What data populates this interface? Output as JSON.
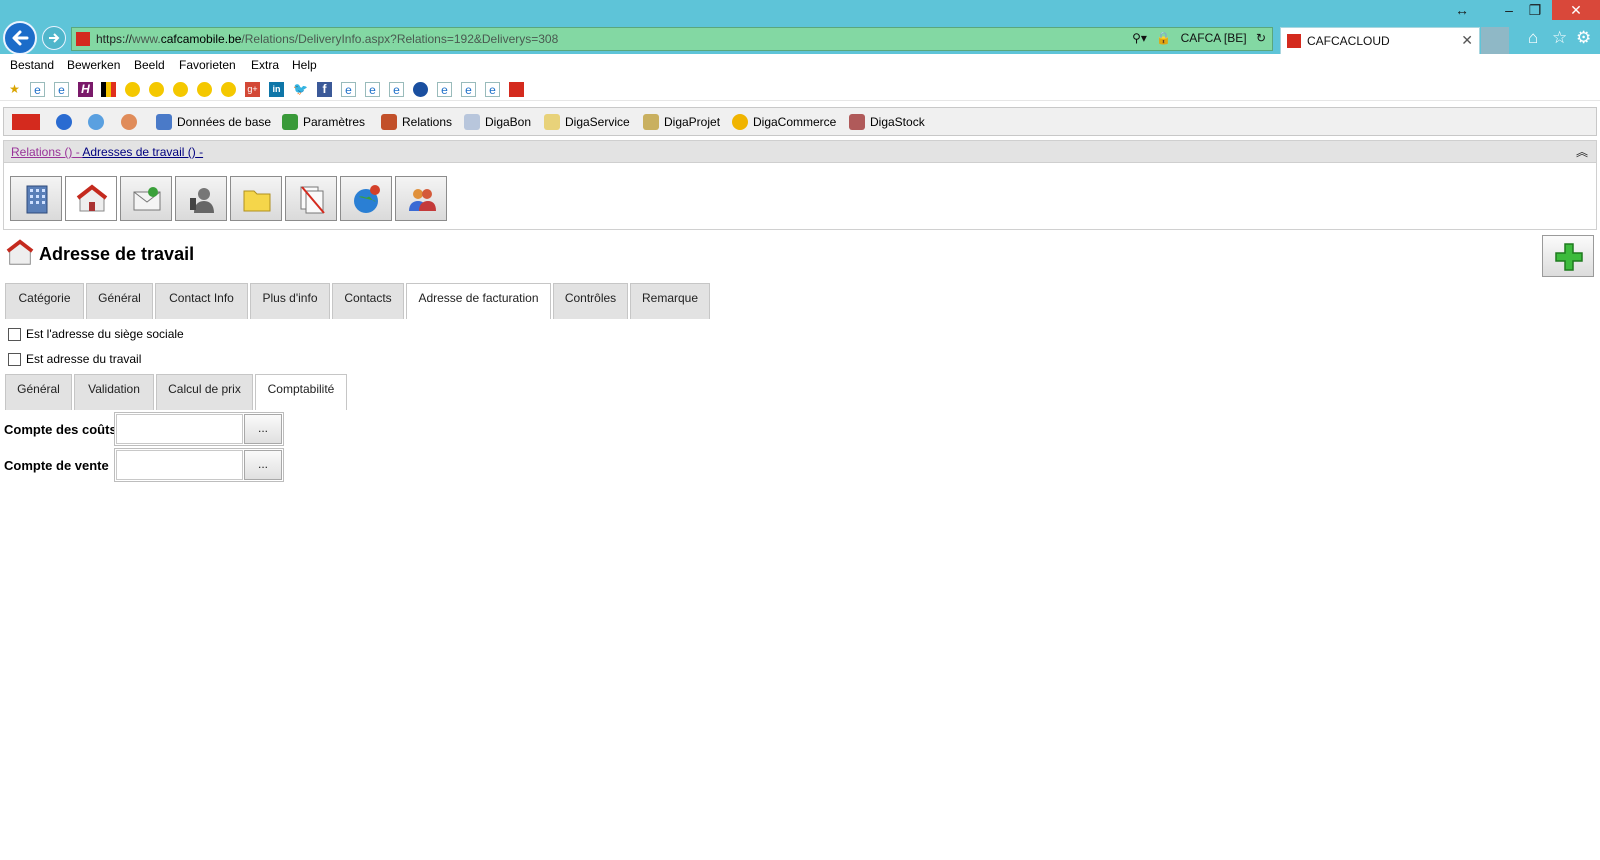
{
  "browser": {
    "url_proto": "https://",
    "url_host_prefix": "www.",
    "url_host": "cafcamobile.be",
    "url_path": "/Relations/DeliveryInfo.aspx?Relations=192&Deliverys=308",
    "site_identity": "CAFCA [BE]",
    "tab_title": "CAFCACLOUD"
  },
  "menu": {
    "items": [
      "Bestand",
      "Bewerken",
      "Beeld",
      "Favorieten",
      "Extra",
      "Help"
    ]
  },
  "app_toolbar": {
    "items": [
      {
        "label": "Données de base"
      },
      {
        "label": "Paramètres"
      },
      {
        "label": "Relations"
      },
      {
        "label": "DigaBon"
      },
      {
        "label": "DigaService"
      },
      {
        "label": "DigaProjet"
      },
      {
        "label": "DigaCommerce"
      },
      {
        "label": "DigaStock"
      }
    ]
  },
  "breadcrumb": {
    "link1": "Relations ()",
    "separator": " - ",
    "link2": "Adresses de travail ()",
    "trail": " -"
  },
  "page": {
    "title": "Adresse de travail"
  },
  "main_tabs": {
    "items": [
      "Catégorie",
      "Général",
      "Contact Info",
      "Plus d'info",
      "Contacts",
      "Adresse de facturation",
      "Contrôles",
      "Remarque"
    ],
    "active": "Adresse de facturation"
  },
  "checkboxes": {
    "siege": "Est l'adresse du siège sociale",
    "travail": "Est adresse du travail"
  },
  "sub_tabs": {
    "items": [
      "Général",
      "Validation",
      "Calcul de prix",
      "Comptabilité"
    ],
    "active": "Comptabilité"
  },
  "fields": {
    "cost": {
      "label": "Compte des coûts",
      "value": "",
      "button": "..."
    },
    "sales": {
      "label": "Compte de vente",
      "value": "",
      "button": "..."
    }
  }
}
